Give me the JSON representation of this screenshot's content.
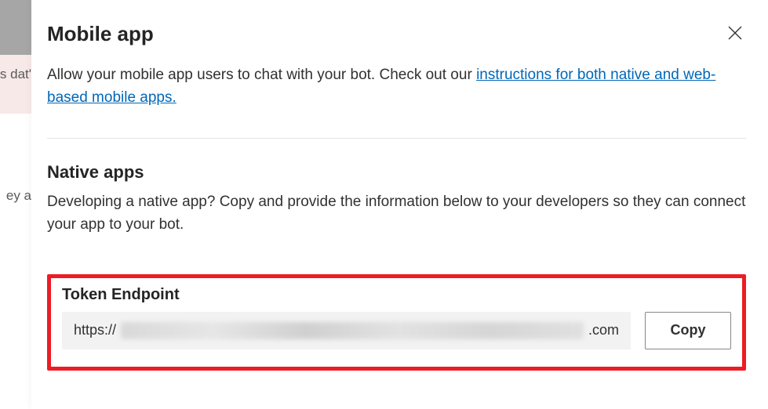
{
  "background": {
    "snippet1": "'s dat",
    "snippet2": "ey a"
  },
  "header": {
    "title": "Mobile app"
  },
  "intro": {
    "text_before_link": "Allow your mobile app users to chat with your bot. Check out our ",
    "link_text": "instructions for both native and web-based mobile apps."
  },
  "native_section": {
    "title": "Native apps",
    "description": "Developing a native app? Copy and provide the information below to your developers so they can connect your app to your bot."
  },
  "token_endpoint": {
    "label": "Token Endpoint",
    "value_prefix": "https://",
    "value_suffix": ".com",
    "copy_button_label": "Copy"
  }
}
